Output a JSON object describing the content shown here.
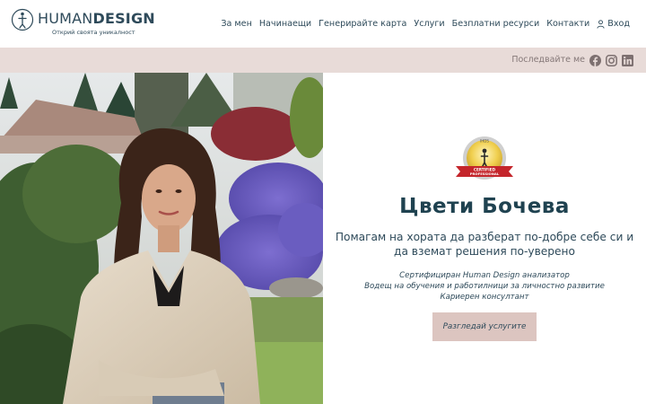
{
  "header": {
    "logo_light": "HUMAN",
    "logo_bold": "DESIGN",
    "logo_tagline": "Открий своята уникалност",
    "logo_icon": "human-design-mark-icon",
    "nav": [
      {
        "label": "За мен"
      },
      {
        "label": "Начинаещи"
      },
      {
        "label": "Генерирайте карта"
      },
      {
        "label": "Услуги"
      },
      {
        "label": "Безплатни ресурси"
      },
      {
        "label": "Контакти"
      }
    ],
    "login_label": "Вход",
    "login_icon": "user-icon"
  },
  "social_bar": {
    "label": "Последвайте ме",
    "icons": [
      "facebook-icon",
      "instagram-icon",
      "linkedin-icon"
    ]
  },
  "hero": {
    "photo": "portrait-garden-photo",
    "badge": {
      "line1": "CERTIFIED",
      "line2": "PROFESSIONAL",
      "top_text": "IHDS"
    },
    "name": "Цвети Бочева",
    "tagline": "Помагам на хората да разберат по-добре себе си и да вземат решения по-уверено",
    "roles": [
      "Сертифициран Human Design анализатор",
      "Водещ на обучения и работилници за личностно развитие",
      "Кариерен консултант"
    ],
    "cta_label": "Разгледай услугите"
  },
  "colors": {
    "primary_text": "#2e4a5a",
    "social_bar_bg": "#e8dbd8",
    "cta_bg": "#dcc5c0",
    "badge_red": "#c4252b",
    "badge_gold": "#e6c24a"
  }
}
